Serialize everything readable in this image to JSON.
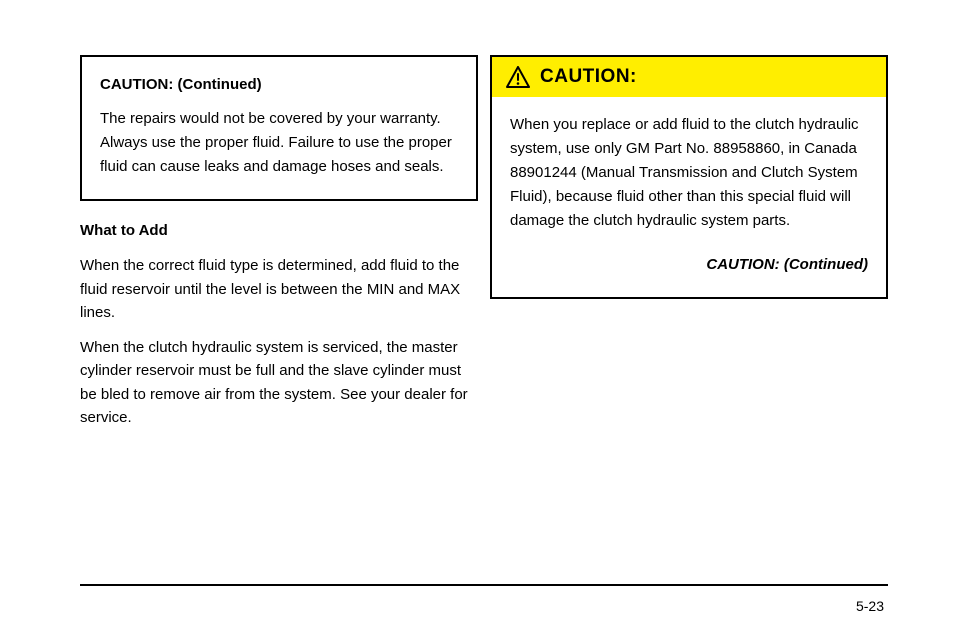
{
  "left": {
    "caution": {
      "continued_label": "CAUTION: (Continued)",
      "body": "The repairs would not be covered by your warranty. Always use the proper fluid. Failure to use the proper fluid can cause leaks and damage hoses and seals."
    },
    "heading": "What to Add",
    "paragraphs": [
      "When the correct fluid type is determined, add fluid to the fluid reservoir until the level is between the MIN and MAX lines.",
      "When the clutch hydraulic system is serviced, the master cylinder reservoir must be full and the slave cylinder must be bled to remove air from the system. See your dealer for service."
    ]
  },
  "right": {
    "caution": {
      "title": "CAUTION:",
      "body": "When you replace or add fluid to the clutch hydraulic system, use only GM Part No. 88958860, in Canada 88901244 (Manual Transmission and Clutch System Fluid), because fluid other than this special fluid will damage the clutch hydraulic system parts.",
      "continued_label": "CAUTION: (Continued)"
    }
  },
  "page_number": "5-23"
}
